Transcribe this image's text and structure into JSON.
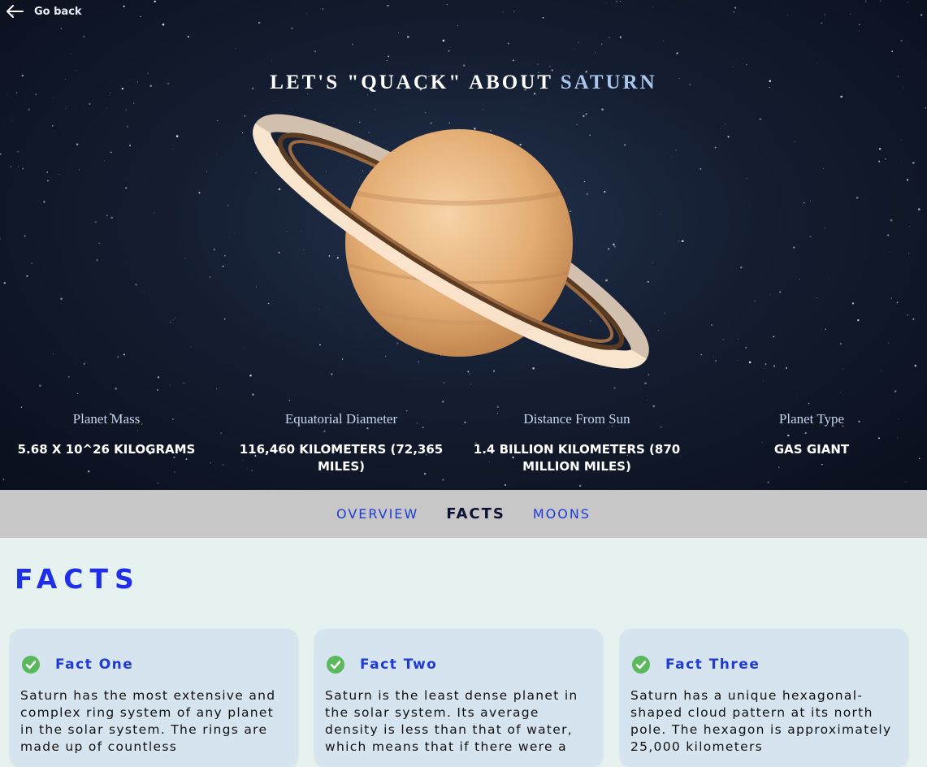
{
  "nav": {
    "back_label": "Go back"
  },
  "hero": {
    "headline_prefix": "LET'S \"QUACK\" ABOUT",
    "planet_name": "SATURN"
  },
  "stats": [
    {
      "label": "Planet Mass",
      "value": "5.68 x 10^26 kilograms"
    },
    {
      "label": "Equatorial Diameter",
      "value": "116,460 kilometers (72,365 miles)"
    },
    {
      "label": "Distance From Sun",
      "value": "1.4 billion kilometers (870 million miles)"
    },
    {
      "label": "Planet Type",
      "value": "Gas Giant"
    }
  ],
  "tabs": [
    {
      "label": "OVERVIEW",
      "active": false
    },
    {
      "label": "FACTS",
      "active": true
    },
    {
      "label": "MOONS",
      "active": false
    }
  ],
  "section": {
    "title": "FACTS"
  },
  "facts": [
    {
      "title": "Fact One",
      "text": "Saturn has the most extensive and complex ring system of any planet in the solar system. The rings are made up of countless"
    },
    {
      "title": "Fact Two",
      "text": "Saturn is the least dense planet in the solar system. Its average density is less than that of water, which means that if there were a"
    },
    {
      "title": "Fact Three",
      "text": "Saturn has a unique hexagonal-shaped cloud pattern at its north pole. The hexagon is approximately 25,000 kilometers"
    }
  ],
  "icons": {
    "back": "arrow-left-icon",
    "check": "check-badge-icon",
    "planet": "saturn-illustration"
  },
  "colors": {
    "accent": "#1f3bd6",
    "section_title": "#1f2fe8",
    "check_green": "#5cb85c",
    "tab_bar": "#c7c7c7",
    "card_bg": "#d6e4ef",
    "page_bg": "#e6f2ef"
  }
}
